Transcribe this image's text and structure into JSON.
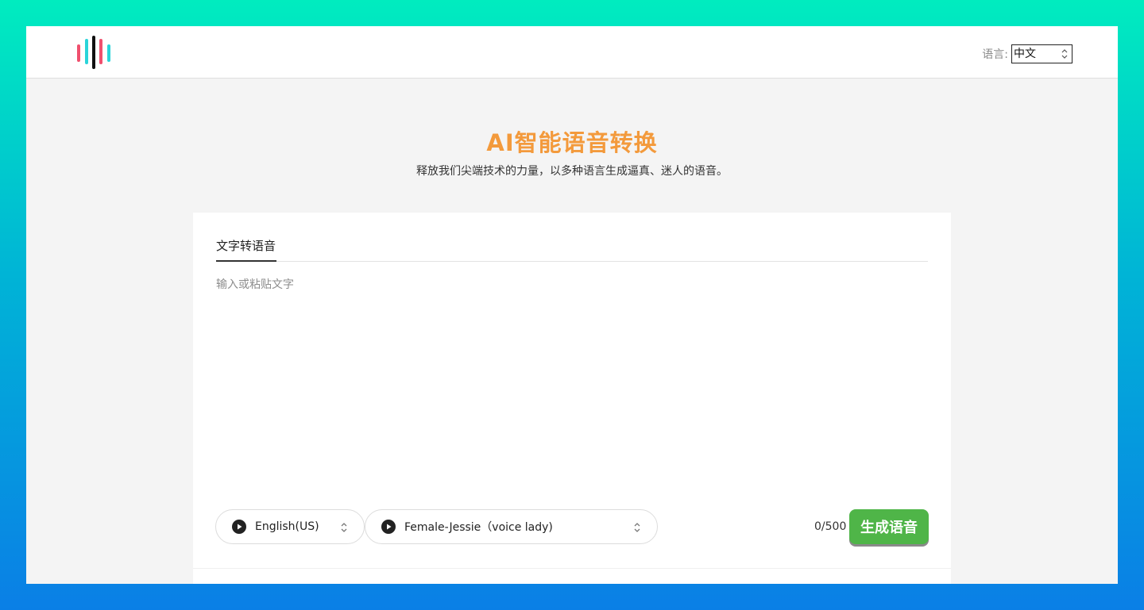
{
  "header": {
    "logo_icon": "sound-wave-logo",
    "language_label": "语言:",
    "language_selected": "中文"
  },
  "hero": {
    "title": "AI智能语音转换",
    "subtitle": "释放我们尖端技术的力量，以多种语言生成逼真、迷人的语音。"
  },
  "card": {
    "tabs": [
      {
        "label": "文字转语音",
        "active": true
      }
    ],
    "textarea": {
      "value": "",
      "placeholder": "输入或粘贴文字"
    },
    "language_select": {
      "value": "English(US)",
      "icon": "play-icon"
    },
    "voice_select": {
      "value": "Female-Jessie（voice lady)",
      "icon": "play-icon"
    },
    "char_counter": "0/500",
    "generate_button": "生成语音"
  },
  "colors": {
    "accent_orange": "#f39a3c",
    "button_green": "#4fb548",
    "logo_red": "#f0506e",
    "logo_cyan": "#2ad4d9",
    "logo_black": "#111111"
  }
}
